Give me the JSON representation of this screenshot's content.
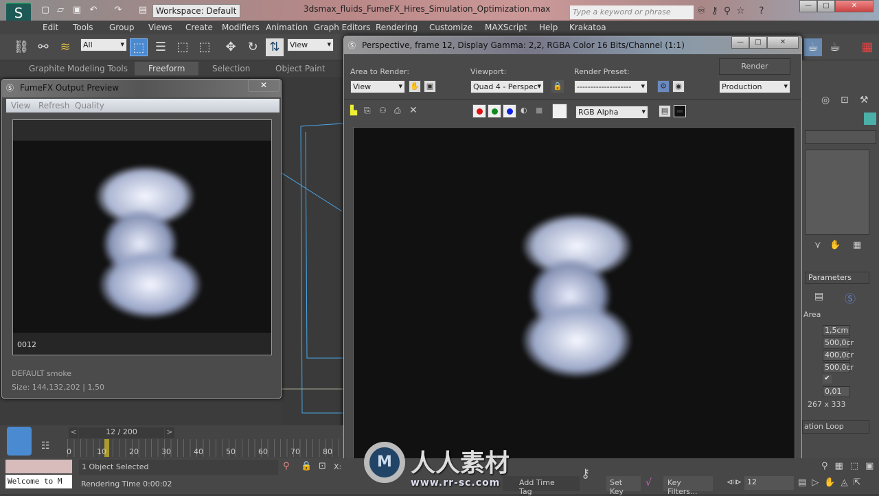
{
  "titlebar": {
    "workspace": "Workspace: Default",
    "title": "3dsmax_fluids_FumeFX_Hires_Simulation_Optimization.max",
    "search_placeholder": "Type a keyword or phrase"
  },
  "menu": [
    "Edit",
    "Tools",
    "Group",
    "Views",
    "Create",
    "Modifiers",
    "Animation",
    "Graph Editors",
    "Rendering",
    "Customize",
    "MAXScript",
    "Help",
    "Krakatoa"
  ],
  "toolbar": {
    "selection_filter": "All",
    "ref_coord": "View"
  },
  "ribbon": {
    "tabs": [
      "Graphite Modeling Tools",
      "Freeform",
      "Selection",
      "Object Paint"
    ],
    "active": "Freeform"
  },
  "fumefx": {
    "title": "FumeFX Output Preview",
    "menu": [
      "View",
      "Refresh",
      "Quality"
    ],
    "frame": "0012",
    "info1": "DEFAULT smoke",
    "info2": "Size: 144,132,202 | 1,50"
  },
  "render_frame": {
    "title": "Perspective, frame 12, Display Gamma: 2,2, RGBA Color 16 Bits/Channel (1:1)",
    "area_label": "Area to Render:",
    "area_value": "View",
    "viewport_label": "Viewport:",
    "viewport_value": "Quad 4 - Perspec",
    "preset_label": "Render Preset:",
    "preset_value": "--------------------",
    "render_button": "Render",
    "mode_value": "Production",
    "channel_value": "RGB Alpha",
    "colors": {
      "red": "#e01010",
      "green": "#108a20",
      "blue": "#1020e0"
    }
  },
  "right_panel": {
    "rollout": "Parameters",
    "group": "Area",
    "values": [
      "1,5cm",
      "500,0cr",
      "400,0cr",
      "500,0cr"
    ],
    "checked": true,
    "value2": "0,01",
    "resolution": "267 x 333",
    "button": "ation Loop"
  },
  "timeline": {
    "frame": "12 / 200",
    "ticks": [
      "0",
      "10",
      "20",
      "30",
      "40",
      "50",
      "60",
      "70",
      "80"
    ]
  },
  "status": {
    "listener": "Welcome to M",
    "selected": "1 Object Selected",
    "rendering_time": "Rendering Time  0:00:02",
    "time_tag": "Add Time Tag",
    "set_key": "Set Key",
    "key_filters": "Key Filters...",
    "current_frame": "12"
  },
  "watermark": {
    "text": "人人素材",
    "url": "www.rr-sc.com"
  }
}
